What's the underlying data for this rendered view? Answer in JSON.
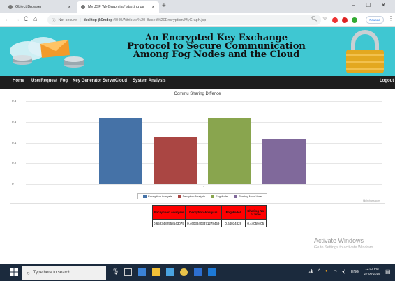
{
  "browser": {
    "tabs": [
      {
        "label": "Object Browser",
        "active": false
      },
      {
        "label": "My JSF 'MyGraph.jsp' starting pa",
        "active": true
      }
    ],
    "new_tab_label": "+",
    "not_secure_label": "Not secure",
    "url_host": "desktop-jk0mdop",
    "url_path": ":4040/Attribute%20-Based%20Encryption/MyGraph.jsp",
    "paused_label": "Paused",
    "window_controls": [
      "–",
      "☐",
      "✕"
    ]
  },
  "banner": {
    "title_line1": "An Encrypted Key Exchange",
    "title_line2": "Protocol to Secure Communication",
    "title_line3": "Among Fog Nodes and the Cloud",
    "bg_color": "#3fc7d2"
  },
  "nav": {
    "items": [
      "Home",
      "UserRequest",
      "Fog",
      "Key Generator Server",
      "Cloud",
      "System Analysis"
    ],
    "logout_label": "Logout"
  },
  "chart_data": {
    "type": "bar",
    "title": "Commu Sharing Diffence",
    "xlabel": "",
    "ylabel": "",
    "categories": [
      "1"
    ],
    "ylim": [
      0,
      0.8
    ],
    "yticks": [
      "0",
      "0.2",
      "0.4",
      "0.6",
      "0.8"
    ],
    "grid": true,
    "legend_position": "bottom",
    "series": [
      {
        "name": "Encryption Analysis",
        "values": [
          0.64
        ],
        "color": "#4572a7"
      },
      {
        "name": "Decrytion Analysis",
        "values": [
          0.46
        ],
        "color": "#aa4643"
      },
      {
        "name": "FogModel",
        "values": [
          0.64
        ],
        "color": "#89a54e"
      },
      {
        "name": "Sharing No of time",
        "values": [
          0.44
        ],
        "color": "#80699b"
      }
    ],
    "credit": "Highcharts.com"
  },
  "table": {
    "headers": [
      "Encryption Analysis",
      "Decrytion Analysis",
      "FogModel",
      "Sharing No of time"
    ],
    "values": [
      "0.6593482558543079",
      "0.46038403371278459",
      "0.64034828",
      "0.44059405"
    ]
  },
  "watermark": {
    "line1": "Activate Windows",
    "line2": "Go to Settings to activate Windows."
  },
  "taskbar": {
    "search_placeholder": "Type here to search",
    "time": "12:03 PM",
    "date": "27-06-2019",
    "lang": "ENG"
  }
}
